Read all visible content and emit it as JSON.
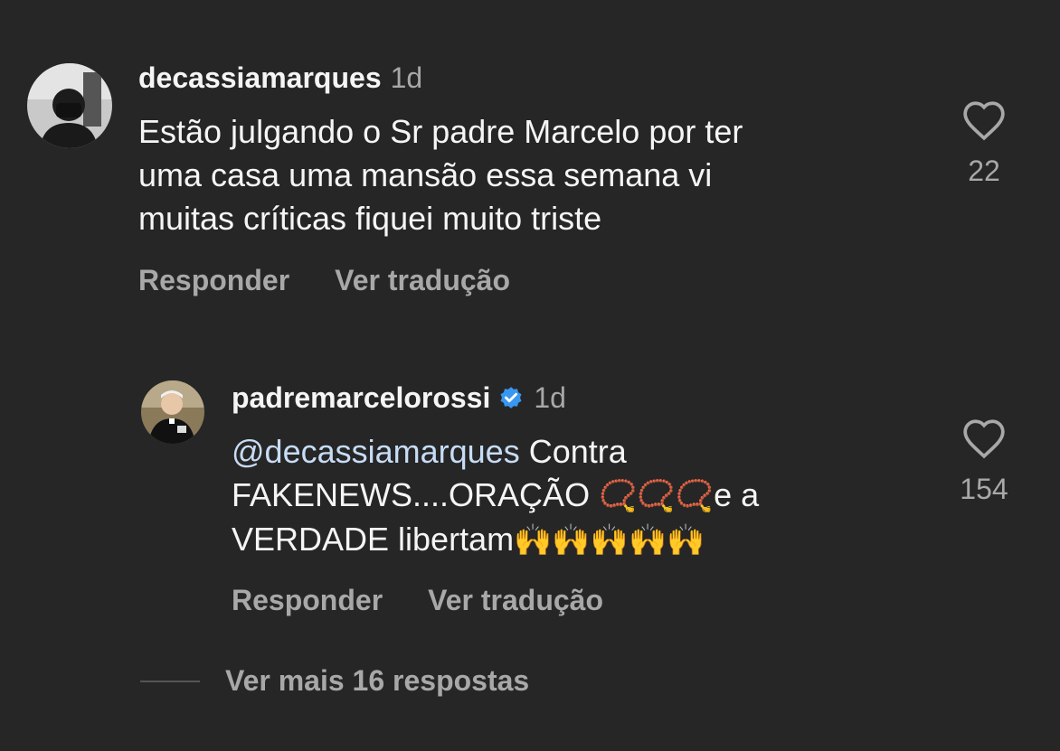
{
  "comments": [
    {
      "username": "decassiamarques",
      "time": "1d",
      "lines": [
        "Estão julgando o Sr padre Marcelo por ter",
        "uma casa uma mansão essa semana vi",
        "muitas críticas fiquei muito triste"
      ],
      "likes": "22",
      "reply_label": "Responder",
      "translate_label": "Ver tradução"
    },
    {
      "username": "padremarcelorossi",
      "verified": true,
      "time": "1d",
      "mention": "@decassiamarques",
      "line1_rest": " Contra",
      "line2": "FAKENEWS....ORAÇÃO ",
      "line2_emoji": "📿📿📿",
      "line2_rest": "e a",
      "line3": "VERDADE libertam",
      "line3_emoji": "🙌🙌🙌🙌🙌",
      "likes": "154",
      "reply_label": "Responder",
      "translate_label": "Ver tradução"
    }
  ],
  "more_replies": "Ver mais 16 respostas",
  "colors": {
    "background": "#262626",
    "text": "#f5f5f5",
    "muted": "#a8a8a8",
    "verified": "#3897f0"
  }
}
